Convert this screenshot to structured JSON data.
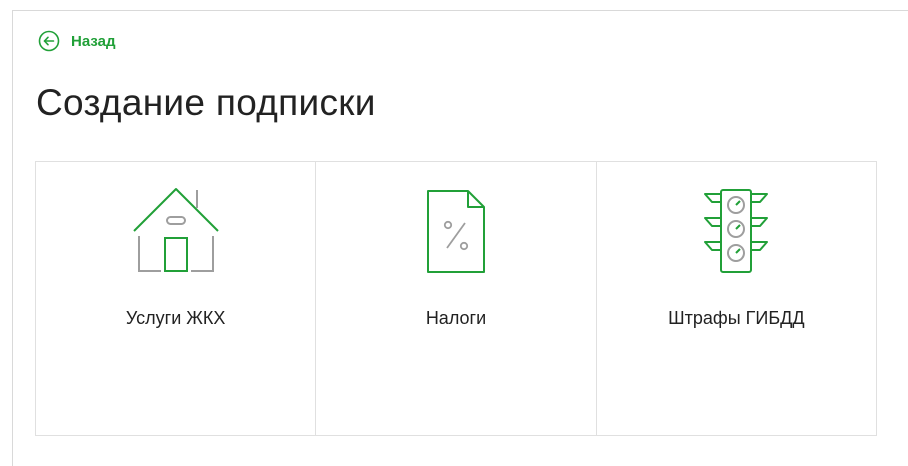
{
  "nav": {
    "back_label": "Назад"
  },
  "page": {
    "title": "Создание подписки"
  },
  "tiles": [
    {
      "label": "Услуги ЖКХ",
      "icon": "house-icon"
    },
    {
      "label": "Налоги",
      "icon": "tax-document-icon"
    },
    {
      "label": "Штрафы ГИБДД",
      "icon": "traffic-light-icon"
    }
  ],
  "colors": {
    "accent": "#21a038",
    "icon_gray": "#9e9e9e",
    "border": "#e0e0e0"
  }
}
